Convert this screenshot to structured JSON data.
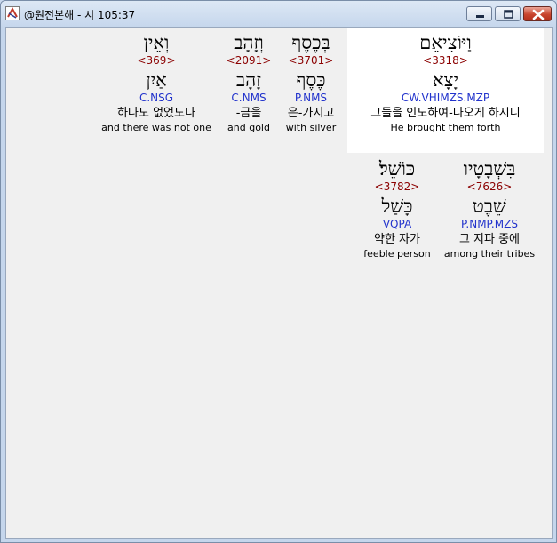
{
  "window": {
    "title": "@원전본해 - 시 105:37"
  },
  "title_buttons": {
    "minimize_icon": "minimize-icon",
    "maximize_icon": "maximize-icon",
    "close_icon": "close-icon"
  },
  "colors": {
    "strong": "#8b0000",
    "morph": "#2233cc",
    "highlight": "#ffffff",
    "panel": "#f0f0f0"
  },
  "words": [
    {
      "hebrew": "וַיּוֹצִיאֵם",
      "strong": "<3318>",
      "lexeme": "יָצָא",
      "morph": "CW.VHIMZS.MZP",
      "korean": "그들을 인도하여-나오게 하시니",
      "english": "He brought them forth",
      "highlighted": true
    },
    {
      "hebrew": "בְּכֶסֶף",
      "strong": "<3701>",
      "lexeme": "כֶּסֶף",
      "morph": "P.NMS",
      "korean": "은-가지고",
      "english": "with silver",
      "highlighted": false
    },
    {
      "hebrew": "וְזָהָב",
      "strong": "<2091>",
      "lexeme": "זָהָב",
      "morph": "C.NMS",
      "korean": "-금을",
      "english": "and gold",
      "highlighted": false
    },
    {
      "hebrew": "וְאֵין",
      "strong": "<369>",
      "lexeme": "אַיִן",
      "morph": "C.NSG",
      "korean": "하나도 없었도다",
      "english": "and there was not one",
      "highlighted": false
    },
    {
      "hebrew": "בִּשְׁבָטָיו",
      "strong": "<7626>",
      "lexeme": "שֵׁבֶט",
      "morph": "P.NMP.MZS",
      "korean": "그 지파 중에",
      "english": "among their tribes",
      "highlighted": false
    },
    {
      "hebrew": "כּוֹשֵׁל׃",
      "strong": "<3782>",
      "lexeme": "כָּשַׁל",
      "morph": "VQPA",
      "korean": "약한 자가",
      "english": "feeble person",
      "highlighted": false
    }
  ]
}
